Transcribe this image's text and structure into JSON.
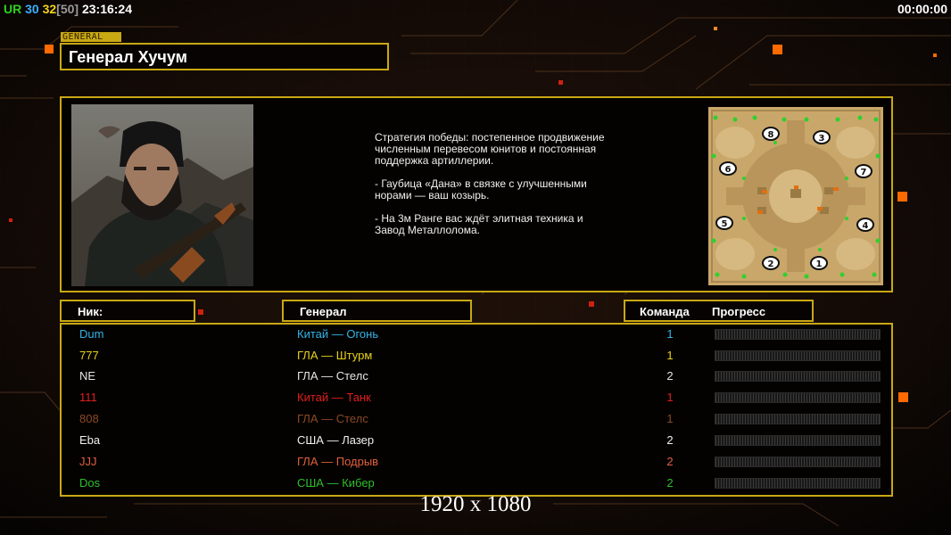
{
  "hud": {
    "left_parts": [
      {
        "text": "UR",
        "color": "#2fd01f"
      },
      {
        "text": " 30",
        "color": "#3cb0ff"
      },
      {
        "text": " 32",
        "color": "#f2d21a"
      },
      {
        "text": "[50]",
        "color": "#9a9a9a"
      },
      {
        "text": " 23:16:24",
        "color": "#ffffff"
      }
    ],
    "timer": "00:00:00"
  },
  "tag": "GENERAL",
  "general_name": "Генерал Хучум",
  "description": "Стратегия победы: постепенное продвижение численным перевесом юнитов и постоянная поддержка артиллерии.\n\n- Гаубица «Дана» в связке с улучшенными норами — ваш козырь.\n\n- На 3м Ранге вас ждёт элитная техника и Завод Металлолома.",
  "headers": {
    "nick": "Ник:",
    "general": "Генерал",
    "team": "Команда",
    "progress": "Прогресс"
  },
  "map_slots": [
    "8",
    "3",
    "6",
    "7",
    "5",
    "4",
    "2",
    "1"
  ],
  "players": [
    {
      "nick": "Dum",
      "general": "Китай — Огонь",
      "team": "1",
      "color": "#31b3e6",
      "progress": 0
    },
    {
      "nick": "777",
      "general": "ГЛА — Штурм",
      "team": "1",
      "color": "#e8d21a",
      "progress": 0
    },
    {
      "nick": "NE",
      "general": "ГЛА — Стелс",
      "team": "2",
      "color": "#e6e6e6",
      "progress": 0
    },
    {
      "nick": "111",
      "general": "Китай — Танк",
      "team": "1",
      "color": "#e01e1e",
      "progress": 0
    },
    {
      "nick": "808",
      "general": "ГЛА — Стелс",
      "team": "1",
      "color": "#8a4a24",
      "progress": 0
    },
    {
      "nick": "Eba",
      "general": "США — Лазер",
      "team": "2",
      "color": "#f0f0f0",
      "progress": 0
    },
    {
      "nick": "JJJ",
      "general": "ГЛА — Подрыв",
      "team": "2",
      "color": "#e0603c",
      "progress": 0
    },
    {
      "nick": "Dos",
      "general": "США — Кибер",
      "team": "2",
      "color": "#2fbf2f",
      "progress": 0
    }
  ],
  "watermark": "1920 x 1080",
  "colors": {
    "frame": "#c9a814",
    "background": "#120b08",
    "accent": "#ff7a00"
  }
}
